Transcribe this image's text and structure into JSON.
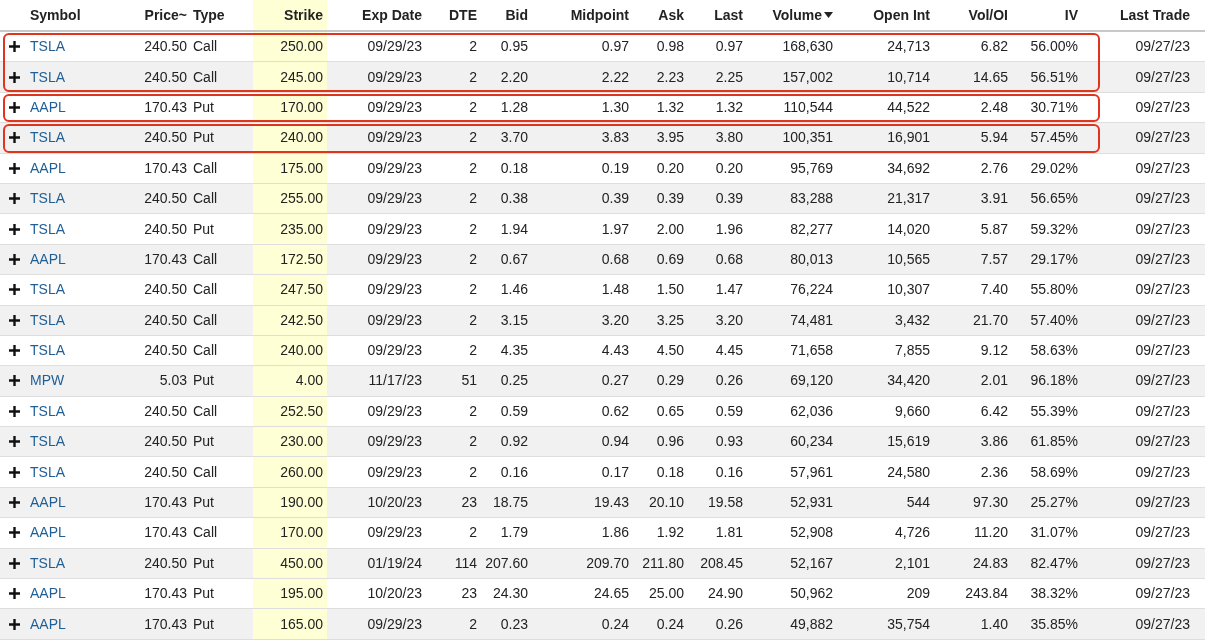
{
  "table": {
    "columns": [
      {
        "label": "Symbol",
        "sorted": false
      },
      {
        "label": "Price~",
        "sorted": false
      },
      {
        "label": "Type",
        "sorted": false
      },
      {
        "label": "Strike",
        "sorted": false
      },
      {
        "label": "Exp Date",
        "sorted": false
      },
      {
        "label": "DTE",
        "sorted": false
      },
      {
        "label": "Bid",
        "sorted": false
      },
      {
        "label": "Midpoint",
        "sorted": false
      },
      {
        "label": "Ask",
        "sorted": false
      },
      {
        "label": "Last",
        "sorted": false
      },
      {
        "label": "Volume",
        "sorted": true
      },
      {
        "label": "Open Int",
        "sorted": false
      },
      {
        "label": "Vol/OI",
        "sorted": false
      },
      {
        "label": "IV",
        "sorted": false
      },
      {
        "label": "Last Trade",
        "sorted": false
      }
    ],
    "row_groups": [
      {
        "outlined": true,
        "rows": [
          {
            "cells": [
              "TSLA",
              "240.50",
              "Call",
              "250.00",
              "09/29/23",
              "2",
              "0.95",
              "0.97",
              "0.98",
              "0.97",
              "168,630",
              "24,713",
              "6.82",
              "56.00%",
              "09/27/23"
            ]
          },
          {
            "cells": [
              "TSLA",
              "240.50",
              "Call",
              "245.00",
              "09/29/23",
              "2",
              "2.20",
              "2.22",
              "2.23",
              "2.25",
              "157,002",
              "10,714",
              "14.65",
              "56.51%",
              "09/27/23"
            ]
          }
        ]
      },
      {
        "outlined": true,
        "rows": [
          {
            "cells": [
              "AAPL",
              "170.43",
              "Put",
              "170.00",
              "09/29/23",
              "2",
              "1.28",
              "1.30",
              "1.32",
              "1.32",
              "110,544",
              "44,522",
              "2.48",
              "30.71%",
              "09/27/23"
            ]
          }
        ]
      },
      {
        "outlined": true,
        "rows": [
          {
            "cells": [
              "TSLA",
              "240.50",
              "Put",
              "240.00",
              "09/29/23",
              "2",
              "3.70",
              "3.83",
              "3.95",
              "3.80",
              "100,351",
              "16,901",
              "5.94",
              "57.45%",
              "09/27/23"
            ]
          }
        ]
      },
      {
        "outlined": false,
        "rows": [
          {
            "cells": [
              "AAPL",
              "170.43",
              "Call",
              "175.00",
              "09/29/23",
              "2",
              "0.18",
              "0.19",
              "0.20",
              "0.20",
              "95,769",
              "34,692",
              "2.76",
              "29.02%",
              "09/27/23"
            ]
          },
          {
            "cells": [
              "TSLA",
              "240.50",
              "Call",
              "255.00",
              "09/29/23",
              "2",
              "0.38",
              "0.39",
              "0.39",
              "0.39",
              "83,288",
              "21,317",
              "3.91",
              "56.65%",
              "09/27/23"
            ]
          },
          {
            "cells": [
              "TSLA",
              "240.50",
              "Put",
              "235.00",
              "09/29/23",
              "2",
              "1.94",
              "1.97",
              "2.00",
              "1.96",
              "82,277",
              "14,020",
              "5.87",
              "59.32%",
              "09/27/23"
            ]
          },
          {
            "cells": [
              "AAPL",
              "170.43",
              "Call",
              "172.50",
              "09/29/23",
              "2",
              "0.67",
              "0.68",
              "0.69",
              "0.68",
              "80,013",
              "10,565",
              "7.57",
              "29.17%",
              "09/27/23"
            ]
          },
          {
            "cells": [
              "TSLA",
              "240.50",
              "Call",
              "247.50",
              "09/29/23",
              "2",
              "1.46",
              "1.48",
              "1.50",
              "1.47",
              "76,224",
              "10,307",
              "7.40",
              "55.80%",
              "09/27/23"
            ]
          },
          {
            "cells": [
              "TSLA",
              "240.50",
              "Call",
              "242.50",
              "09/29/23",
              "2",
              "3.15",
              "3.20",
              "3.25",
              "3.20",
              "74,481",
              "3,432",
              "21.70",
              "57.40%",
              "09/27/23"
            ]
          },
          {
            "cells": [
              "TSLA",
              "240.50",
              "Call",
              "240.00",
              "09/29/23",
              "2",
              "4.35",
              "4.43",
              "4.50",
              "4.45",
              "71,658",
              "7,855",
              "9.12",
              "58.63%",
              "09/27/23"
            ]
          },
          {
            "cells": [
              "MPW",
              "5.03",
              "Put",
              "4.00",
              "11/17/23",
              "51",
              "0.25",
              "0.27",
              "0.29",
              "0.26",
              "69,120",
              "34,420",
              "2.01",
              "96.18%",
              "09/27/23"
            ]
          },
          {
            "cells": [
              "TSLA",
              "240.50",
              "Call",
              "252.50",
              "09/29/23",
              "2",
              "0.59",
              "0.62",
              "0.65",
              "0.59",
              "62,036",
              "9,660",
              "6.42",
              "55.39%",
              "09/27/23"
            ]
          },
          {
            "cells": [
              "TSLA",
              "240.50",
              "Put",
              "230.00",
              "09/29/23",
              "2",
              "0.92",
              "0.94",
              "0.96",
              "0.93",
              "60,234",
              "15,619",
              "3.86",
              "61.85%",
              "09/27/23"
            ]
          },
          {
            "cells": [
              "TSLA",
              "240.50",
              "Call",
              "260.00",
              "09/29/23",
              "2",
              "0.16",
              "0.17",
              "0.18",
              "0.16",
              "57,961",
              "24,580",
              "2.36",
              "58.69%",
              "09/27/23"
            ]
          },
          {
            "cells": [
              "AAPL",
              "170.43",
              "Put",
              "190.00",
              "10/20/23",
              "23",
              "18.75",
              "19.43",
              "20.10",
              "19.58",
              "52,931",
              "544",
              "97.30",
              "25.27%",
              "09/27/23"
            ]
          },
          {
            "cells": [
              "AAPL",
              "170.43",
              "Call",
              "170.00",
              "09/29/23",
              "2",
              "1.79",
              "1.86",
              "1.92",
              "1.81",
              "52,908",
              "4,726",
              "11.20",
              "31.07%",
              "09/27/23"
            ]
          },
          {
            "cells": [
              "TSLA",
              "240.50",
              "Put",
              "450.00",
              "01/19/24",
              "114",
              "207.60",
              "209.70",
              "211.80",
              "208.45",
              "52,167",
              "2,101",
              "24.83",
              "82.47%",
              "09/27/23"
            ]
          },
          {
            "cells": [
              "AAPL",
              "170.43",
              "Put",
              "195.00",
              "10/20/23",
              "23",
              "24.30",
              "24.65",
              "25.00",
              "24.90",
              "50,962",
              "209",
              "243.84",
              "38.32%",
              "09/27/23"
            ]
          },
          {
            "cells": [
              "AAPL",
              "170.43",
              "Put",
              "165.00",
              "09/29/23",
              "2",
              "0.23",
              "0.24",
              "0.24",
              "0.26",
              "49,882",
              "35,754",
              "1.40",
              "35.85%",
              "09/27/23"
            ]
          }
        ]
      }
    ]
  }
}
